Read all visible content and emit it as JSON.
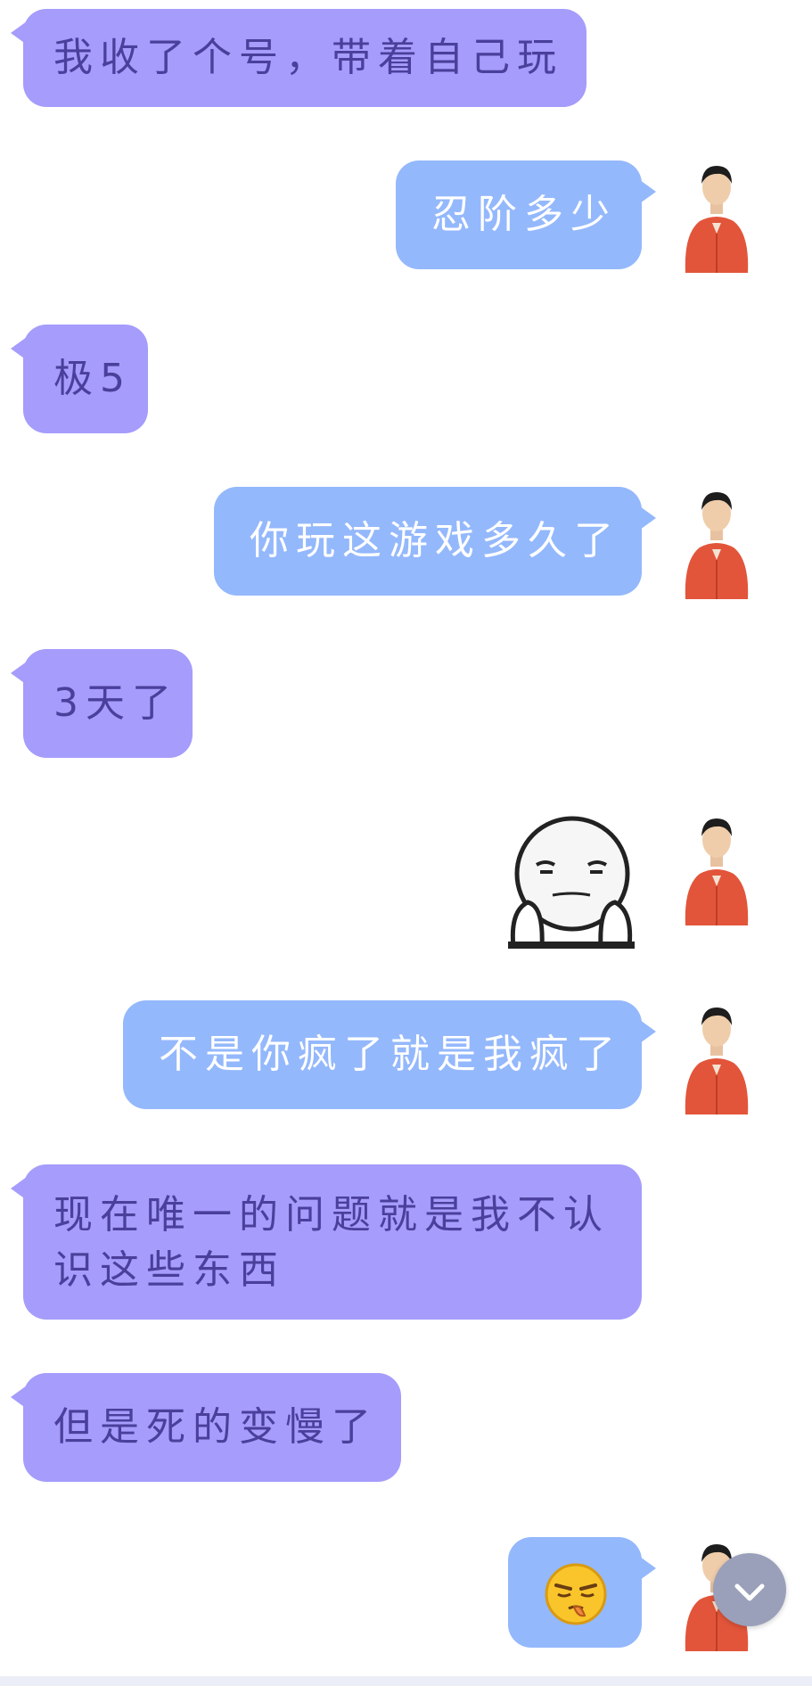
{
  "messages": [
    {
      "side": "left",
      "text": "我收了个号，带着自己玩"
    },
    {
      "side": "right",
      "text": "忍阶多少"
    },
    {
      "side": "left",
      "text": "极5"
    },
    {
      "side": "right",
      "text": "你玩这游戏多久了"
    },
    {
      "side": "left",
      "text": "3天了"
    },
    {
      "side": "right",
      "sticker": "face-palms-sticker"
    },
    {
      "side": "right",
      "text": "不是你疯了就是我疯了"
    },
    {
      "side": "left",
      "text": "现在唯一的问题就是我不认识这些东西"
    },
    {
      "side": "left",
      "text": "但是死的变慢了"
    },
    {
      "side": "right",
      "emoji": "smirk-emoji"
    }
  ],
  "icons": {
    "avatar": "user-avatar-red-robe",
    "scroll": "chevron-down-icon"
  },
  "colors": {
    "left_bubble": "#a59cfc",
    "left_text": "#4a3f9a",
    "right_bubble": "#94b8fc",
    "right_text": "#ffffff",
    "scroll_button": "#9aa0ba"
  }
}
